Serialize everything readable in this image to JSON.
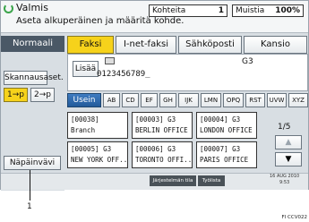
{
  "header": {
    "app_title": "Valmis",
    "message": "Aseta alkuperäinen ja määritä kohde.",
    "counter_label": "Kohteita",
    "counter_value": "1",
    "memory_label": "Muistia",
    "memory_value": "100%"
  },
  "left_panel": {
    "mode": "Normaali",
    "scan_settings": "Skannausaset.",
    "one_sided": "1→p",
    "two_sided": "2→p",
    "preview": "Näpäinvävi"
  },
  "tabs": [
    "Faksi",
    "I-net-faksi",
    "Sähköposti",
    "Kansio"
  ],
  "fax_area": {
    "add_label": "Lisää",
    "number": "0123456789_",
    "mode": "G3"
  },
  "alphabet_tabs": [
    "Usein",
    "AB",
    "CD",
    "EF",
    "GH",
    "IJK",
    "LMN",
    "OPQ",
    "RST",
    "UVW",
    "XYZ"
  ],
  "destinations": [
    {
      "line1": "[00038]",
      "line2": "Branch"
    },
    {
      "line1": "[00003] G3",
      "line2": "BERLIN OFFICE"
    },
    {
      "line1": "[00004] G3",
      "line2": "LONDON OFFICE"
    },
    {
      "line1": "[00005] G3",
      "line2": "NEW YORK OFF.."
    },
    {
      "line1": "[00006] G3",
      "line2": "TORONTO OFFI.."
    },
    {
      "line1": "[00007] G3",
      "line2": "PARIS OFFICE"
    }
  ],
  "pagination": {
    "indicator": "1/5",
    "up": "▲",
    "down": "▼"
  },
  "bottom_bar": {
    "button1": "Järjestelmän tila",
    "button2": "Työlista",
    "date": "16 AUG 2010",
    "time": "9:53"
  },
  "callout": "1",
  "figure_code": "FI CCV022"
}
